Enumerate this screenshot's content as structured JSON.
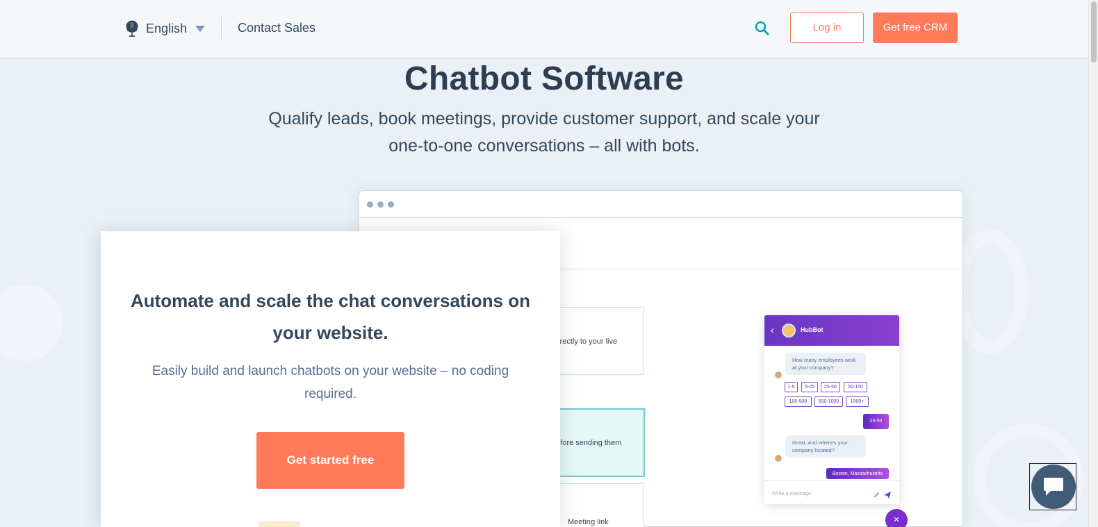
{
  "nav": {
    "language_label": "English",
    "contact_label": "Contact Sales",
    "login_label": "Log in",
    "crm_label": "Get free CRM"
  },
  "hero": {
    "title": "Chatbot Software",
    "subtitle": "Qualify leads, book meetings, provide customer support, and scale your one-to-one conversations – all with bots."
  },
  "panel": {
    "title": "Automate and scale the chat conversations on your website.",
    "text": "Easily build and launch chatbots on your website – no coding required.",
    "cta_label": "Get started free"
  },
  "mockup": {
    "card1_text": "directly to your live",
    "card2_text": "before sending them",
    "card3_text": "Meeting link"
  },
  "chat": {
    "bot_name": "HubBot",
    "q1": "How many employees work at your company?",
    "options": [
      "1-5",
      "5-25",
      "25-50",
      "50-100",
      "100-500",
      "500-1000",
      "1000+"
    ],
    "reply1": "25-50",
    "q2": "Great. And where's your company located?",
    "reply2": "Boston, Massachusetts",
    "input_placeholder": "Write a message"
  },
  "colors": {
    "accent": "#ff7a59",
    "text_dark": "#33475b",
    "bg": "#eaf0f6",
    "bot_purple": "#7a2ed0",
    "teal": "#00a4bd"
  }
}
